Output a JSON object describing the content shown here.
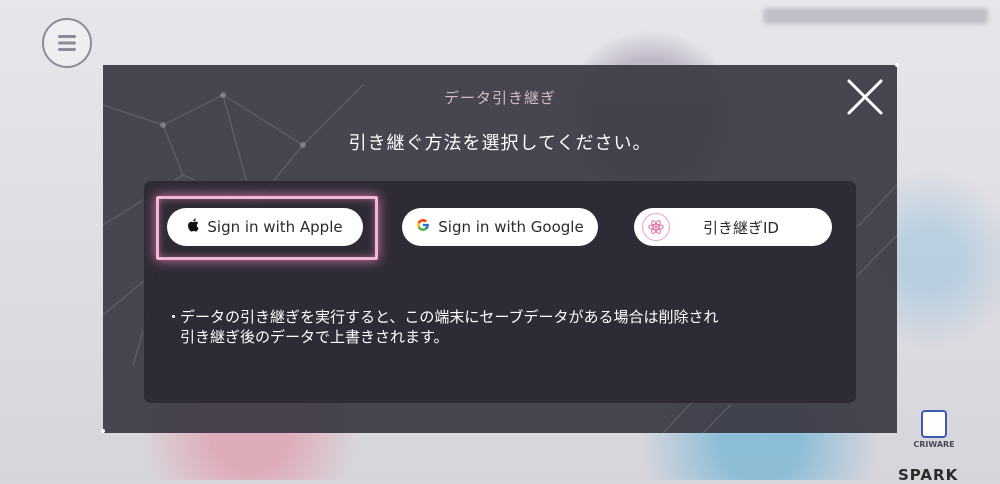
{
  "modal": {
    "title": "データ引き継ぎ",
    "subtitle": "引き継ぐ方法を選択してください。"
  },
  "buttons": {
    "apple": "Sign in with Apple",
    "google": "Sign in with Google",
    "transfer_id": "引き継ぎID"
  },
  "notice": {
    "bullet": "・",
    "line1": "データの引き継ぎを実行すると、この端末にセーブデータがある場合は削除され",
    "line2": "引き継ぎ後のデータで上書きされます。"
  },
  "footer": {
    "criware": "CRIWARE",
    "spark": "SPARK"
  },
  "icons": {
    "menu": "hamburger-menu-icon",
    "close": "close-icon",
    "apple": "apple-logo-icon",
    "google": "google-logo-icon",
    "transfer": "transfer-id-icon"
  },
  "colors": {
    "modal_bg": "#3a3742",
    "highlight": "#f3b6d4",
    "title": "#d7b9c6"
  }
}
